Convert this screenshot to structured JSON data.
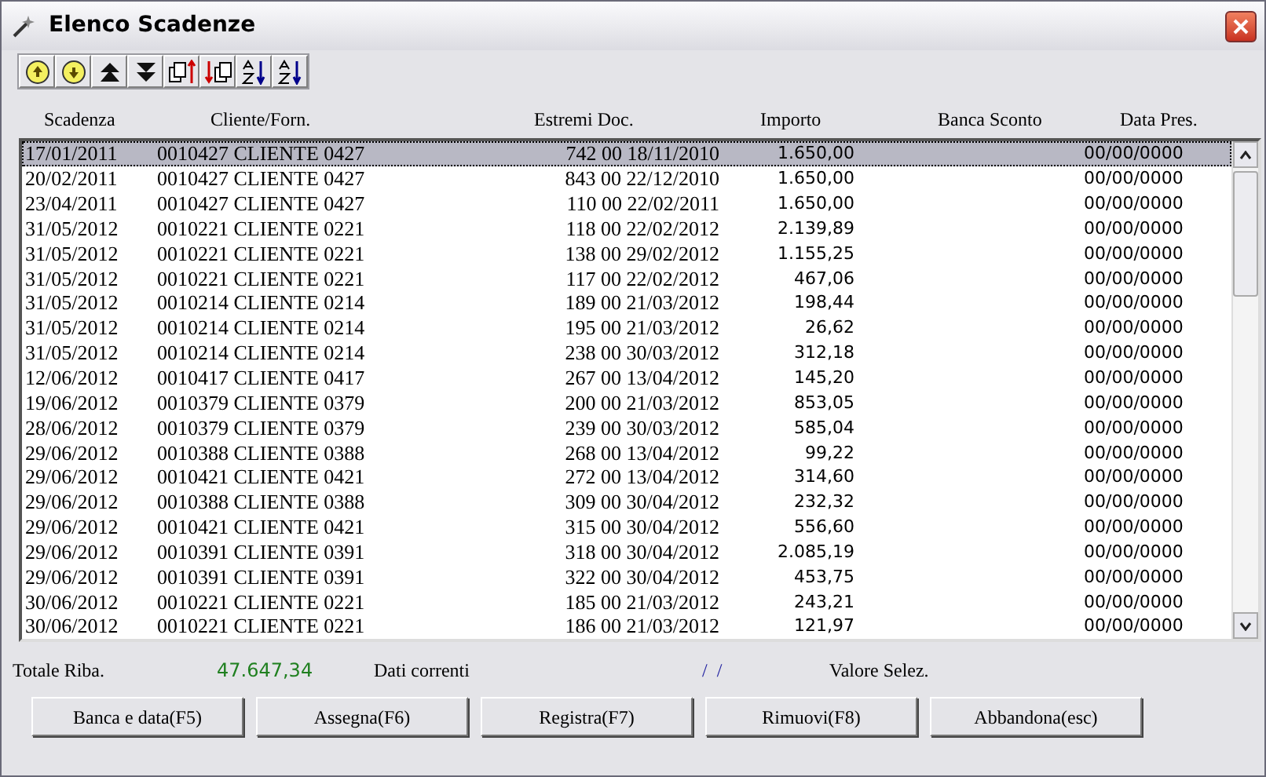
{
  "window": {
    "title": "Elenco Scadenze"
  },
  "table": {
    "columns": [
      "Scadenza",
      "Cliente/Forn.",
      "Estremi Doc.",
      "Importo",
      "Banca Sconto",
      "Data Pres."
    ],
    "rows": [
      {
        "selected": true,
        "scadenza": "17/01/2011",
        "cliente": "0010427 CLIENTE 0427",
        "estremi": "742 00 18/11/2010",
        "importo": "1.650,00",
        "data_pres": "00/00/0000"
      },
      {
        "selected": false,
        "scadenza": "20/02/2011",
        "cliente": "0010427 CLIENTE 0427",
        "estremi": "843 00 22/12/2010",
        "importo": "1.650,00",
        "data_pres": "00/00/0000"
      },
      {
        "selected": false,
        "scadenza": "23/04/2011",
        "cliente": "0010427 CLIENTE 0427",
        "estremi": "110 00 22/02/2011",
        "importo": "1.650,00",
        "data_pres": "00/00/0000"
      },
      {
        "selected": false,
        "scadenza": "31/05/2012",
        "cliente": "0010221 CLIENTE 0221",
        "estremi": "118 00 22/02/2012",
        "importo": "2.139,89",
        "data_pres": "00/00/0000"
      },
      {
        "selected": false,
        "scadenza": "31/05/2012",
        "cliente": "0010221 CLIENTE 0221",
        "estremi": "138 00 29/02/2012",
        "importo": "1.155,25",
        "data_pres": "00/00/0000"
      },
      {
        "selected": false,
        "scadenza": "31/05/2012",
        "cliente": "0010221 CLIENTE 0221",
        "estremi": "117 00 22/02/2012",
        "importo": "467,06",
        "data_pres": "00/00/0000"
      },
      {
        "selected": false,
        "scadenza": "31/05/2012",
        "cliente": "0010214 CLIENTE 0214",
        "estremi": "189 00 21/03/2012",
        "importo": "198,44",
        "data_pres": "00/00/0000"
      },
      {
        "selected": false,
        "scadenza": "31/05/2012",
        "cliente": "0010214 CLIENTE 0214",
        "estremi": "195 00 21/03/2012",
        "importo": "26,62",
        "data_pres": "00/00/0000"
      },
      {
        "selected": false,
        "scadenza": "31/05/2012",
        "cliente": "0010214 CLIENTE 0214",
        "estremi": "238 00 30/03/2012",
        "importo": "312,18",
        "data_pres": "00/00/0000"
      },
      {
        "selected": false,
        "scadenza": "12/06/2012",
        "cliente": "0010417 CLIENTE 0417",
        "estremi": "267 00 13/04/2012",
        "importo": "145,20",
        "data_pres": "00/00/0000"
      },
      {
        "selected": false,
        "scadenza": "19/06/2012",
        "cliente": "0010379 CLIENTE 0379",
        "estremi": "200 00 21/03/2012",
        "importo": "853,05",
        "data_pres": "00/00/0000"
      },
      {
        "selected": false,
        "scadenza": "28/06/2012",
        "cliente": "0010379 CLIENTE 0379",
        "estremi": "239 00 30/03/2012",
        "importo": "585,04",
        "data_pres": "00/00/0000"
      },
      {
        "selected": false,
        "scadenza": "29/06/2012",
        "cliente": "0010388 CLIENTE 0388",
        "estremi": "268 00 13/04/2012",
        "importo": "99,22",
        "data_pres": "00/00/0000"
      },
      {
        "selected": false,
        "scadenza": "29/06/2012",
        "cliente": "0010421 CLIENTE 0421",
        "estremi": "272 00 13/04/2012",
        "importo": "314,60",
        "data_pres": "00/00/0000"
      },
      {
        "selected": false,
        "scadenza": "29/06/2012",
        "cliente": "0010388 CLIENTE 0388",
        "estremi": "309 00 30/04/2012",
        "importo": "232,32",
        "data_pres": "00/00/0000"
      },
      {
        "selected": false,
        "scadenza": "29/06/2012",
        "cliente": "0010421 CLIENTE 0421",
        "estremi": "315 00 30/04/2012",
        "importo": "556,60",
        "data_pres": "00/00/0000"
      },
      {
        "selected": false,
        "scadenza": "29/06/2012",
        "cliente": "0010391 CLIENTE 0391",
        "estremi": "318 00 30/04/2012",
        "importo": "2.085,19",
        "data_pres": "00/00/0000"
      },
      {
        "selected": false,
        "scadenza": "29/06/2012",
        "cliente": "0010391 CLIENTE 0391",
        "estremi": "322 00 30/04/2012",
        "importo": "453,75",
        "data_pres": "00/00/0000"
      },
      {
        "selected": false,
        "scadenza": "30/06/2012",
        "cliente": "0010221 CLIENTE 0221",
        "estremi": "185 00 21/03/2012",
        "importo": "243,21",
        "data_pres": "00/00/0000"
      },
      {
        "selected": false,
        "scadenza": "30/06/2012",
        "cliente": "0010221 CLIENTE 0221",
        "estremi": "186 00 21/03/2012",
        "importo": "121,97",
        "data_pres": "00/00/0000"
      }
    ]
  },
  "summary": {
    "totale_label": "Totale Riba.",
    "totale_value": "47.647,34",
    "dati_label": "Dati correnti",
    "dati_value": "/  /",
    "valore_label": "Valore Selez."
  },
  "buttons": [
    "Banca e data(F5)",
    "Assegna(F6)",
    "Registra(F7)",
    "Rimuovi(F8)",
    "Abbandona(esc)"
  ]
}
